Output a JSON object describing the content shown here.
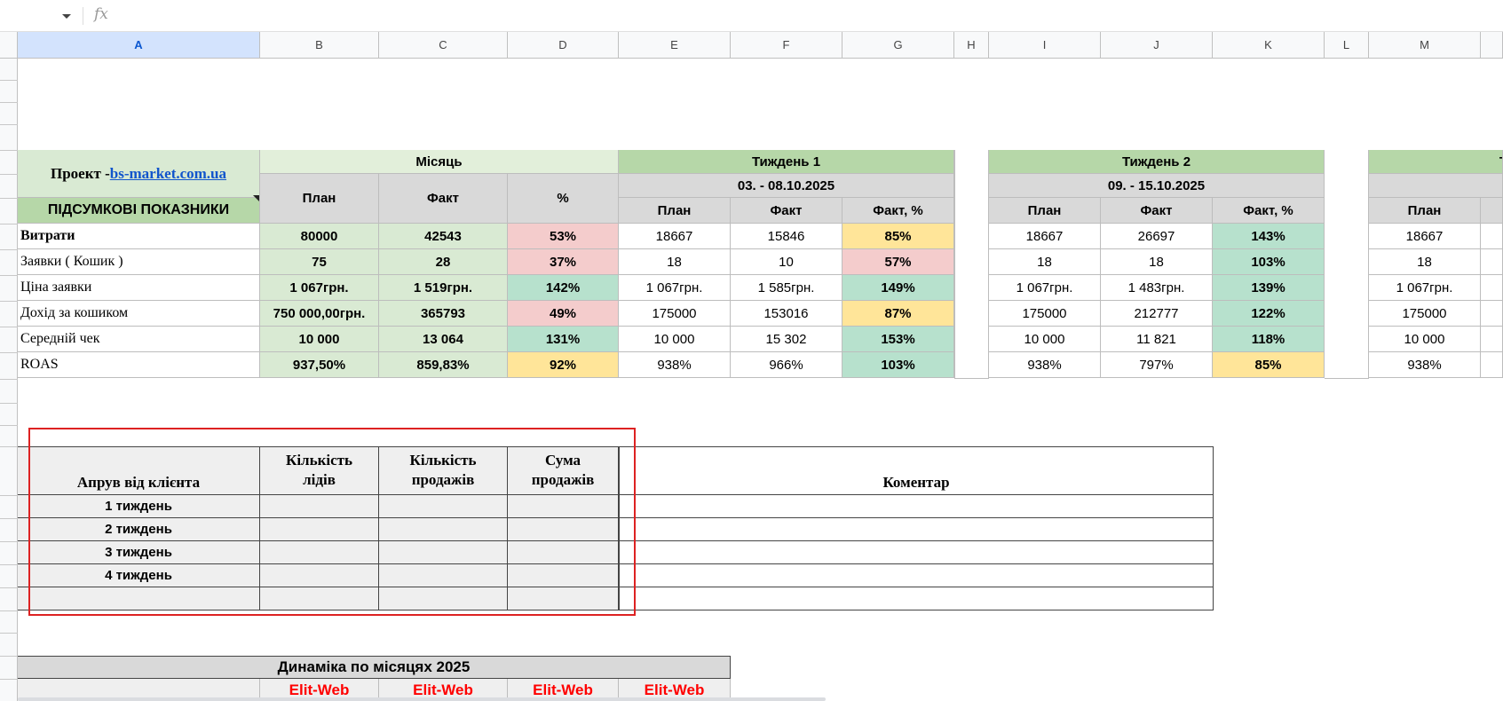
{
  "formula_bar": {
    "fx_label": "fx",
    "value": ""
  },
  "columns": [
    "A",
    "B",
    "C",
    "D",
    "E",
    "F",
    "G",
    "H",
    "I",
    "J",
    "K",
    "L",
    "M"
  ],
  "summary": {
    "project_label": "Проект - ",
    "project_link": "bs-market.com.ua",
    "section_title": "ПІДСУМКОВІ ПОКАЗНИКИ",
    "month_header": "Місяць",
    "month_cols": [
      "План",
      "Факт",
      "%"
    ],
    "week1_header": "Тиждень 1",
    "week1_dates": "03. - 08.10.2025",
    "week2_header": "Тиждень 2",
    "week2_dates": "09. - 15.10.2025",
    "week3_header_partial": "Т",
    "week_cols": [
      "План",
      "Факт",
      "Факт, %"
    ],
    "week3_cols": [
      "План"
    ],
    "rows": [
      {
        "label": "Витрати",
        "m_plan": "80000",
        "m_fact": "42543",
        "m_pct": "53%",
        "w1_plan": "18667",
        "w1_fact": "15846",
        "w1_pct": "85%",
        "w2_plan": "18667",
        "w2_fact": "26697",
        "w2_pct": "143%",
        "w3_plan": "18667"
      },
      {
        "label": "Заявки ( Кошик )",
        "m_plan": "75",
        "m_fact": "28",
        "m_pct": "37%",
        "w1_plan": "18",
        "w1_fact": "10",
        "w1_pct": "57%",
        "w2_plan": "18",
        "w2_fact": "18",
        "w2_pct": "103%",
        "w3_plan": "18"
      },
      {
        "label": "Ціна заявки",
        "m_plan": "1 067грн.",
        "m_fact": "1 519грн.",
        "m_pct": "142%",
        "w1_plan": "1 067грн.",
        "w1_fact": "1 585грн.",
        "w1_pct": "149%",
        "w2_plan": "1 067грн.",
        "w2_fact": "1 483грн.",
        "w2_pct": "139%",
        "w3_plan": "1 067грн."
      },
      {
        "label": "Дохід за кошиком",
        "m_plan": "750 000,00грн.",
        "m_fact": "365793",
        "m_pct": "49%",
        "w1_plan": "175000",
        "w1_fact": "153016",
        "w1_pct": "87%",
        "w2_plan": "175000",
        "w2_fact": "212777",
        "w2_pct": "122%",
        "w3_plan": "175000"
      },
      {
        "label": "Середній чек",
        "m_plan": "10 000",
        "m_fact": "13 064",
        "m_pct": "131%",
        "w1_plan": "10 000",
        "w1_fact": "15 302",
        "w1_pct": "153%",
        "w2_plan": "10 000",
        "w2_fact": "11 821",
        "w2_pct": "118%",
        "w3_plan": "10 000"
      },
      {
        "label": "ROAS",
        "m_plan": "937,50%",
        "m_fact": "859,83%",
        "m_pct": "92%",
        "w1_plan": "938%",
        "w1_fact": "966%",
        "w1_pct": "103%",
        "w2_plan": "938%",
        "w2_fact": "797%",
        "w2_pct": "85%",
        "w3_plan": "938%"
      }
    ]
  },
  "approval": {
    "header_label": "Апрув від клієнта",
    "col_leads": "Кількість\nлідів",
    "col_sales": "Кількість\nпродажів",
    "col_sum": "Сума\nпродажів",
    "col_comment": "Коментар",
    "weeks": [
      "1 тиждень",
      "2 тиждень",
      "3 тиждень",
      "4 тиждень",
      ""
    ]
  },
  "dynamics": {
    "title": "Динаміка по місяцях 2025",
    "brands": [
      "Elit-Web",
      "Elit-Web",
      "Elit-Web",
      "Elit-Web"
    ]
  }
}
